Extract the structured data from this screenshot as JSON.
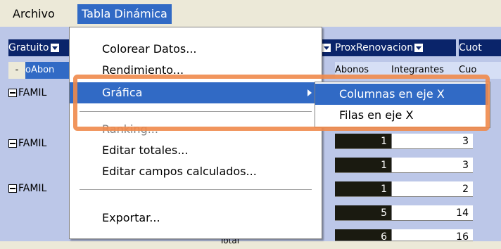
{
  "menubar": {
    "archivo": "Archivo",
    "tabla": "Tabla Dinámica"
  },
  "grid": {
    "header1_left": "Gratuito",
    "header1_right1": "ProxRenovacion",
    "header1_right2": "Cuot",
    "header2_left_btn": "-",
    "header2_left": "oAbon",
    "header2_c1": "Abonos",
    "header2_c2": "Integrantes",
    "header2_c3": "Cuo",
    "row_labels": [
      "FAMIL",
      "FAMIL",
      "FAMIL"
    ],
    "total_label": "Total",
    "rows": [
      {
        "abonos": "1",
        "integrantes": "3"
      },
      {
        "abonos": "1",
        "integrantes": "3"
      },
      {
        "abonos": "1",
        "integrantes": "2"
      },
      {
        "abonos": "5",
        "integrantes": "14"
      },
      {
        "abonos": "6",
        "integrantes": "16"
      }
    ]
  },
  "menu": {
    "items": [
      "Colorear Datos...",
      "Rendimiento...",
      "Gráfica",
      "Ranking...",
      "Editar totales...",
      "Editar campos calculados...",
      "Exportar..."
    ]
  },
  "submenu": {
    "items": [
      "Columnas en eje X",
      "Filas en eje X"
    ]
  },
  "colors": {
    "selection": "#316ac5",
    "highlight": "#f08a4b"
  }
}
